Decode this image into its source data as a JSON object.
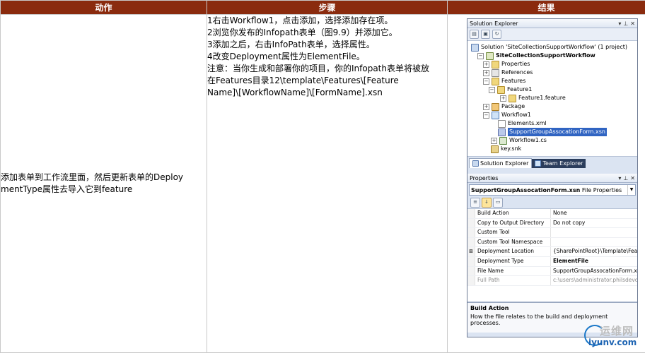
{
  "table": {
    "headers": [
      "动作",
      "步骤",
      "结果"
    ],
    "action_text_line1": "添加表单到工作流里面，然后更新表单的Deploy",
    "action_text_line2": "mentType属性去导入它到feature",
    "steps": [
      "1右击Workflow1，点击添加，选择添加存在项。",
      "2浏览你发布的Infopath表单（图9.9）并添加它。",
      "3添加之后，右击InfoPath表单，选择属性。",
      "4改变Deployment属性为ElementFile。",
      "注意：当你生成和部署你的项目，你的Infopath表单将被放",
      "在Features目录12\\template\\Features\\[Feature",
      "Name]\\[WorkflowName]\\[FormName].xsn"
    ]
  },
  "solution_explorer": {
    "title": "Solution Explorer",
    "title_buttons": [
      "▾",
      "⊥",
      "✕"
    ],
    "tree": [
      {
        "label": "Solution 'SiteCollectionSupportWorkflow' (1 project)",
        "icon": "solution-icon",
        "expander": ""
      },
      {
        "label": "SiteCollectionSupportWorkflow",
        "icon": "project-icon",
        "expander": "−"
      },
      {
        "label": "Properties",
        "icon": "folder-icon",
        "expander": "+"
      },
      {
        "label": "References",
        "icon": "references-icon",
        "expander": "+"
      },
      {
        "label": "Features",
        "icon": "folder-icon",
        "expander": "−"
      },
      {
        "label": "Feature1",
        "icon": "folder-icon",
        "expander": "−"
      },
      {
        "label": "Feature1.feature",
        "icon": "feature-icon",
        "expander": "+"
      },
      {
        "label": "Package",
        "icon": "package-icon",
        "expander": "+"
      },
      {
        "label": "Workflow1",
        "icon": "workflow-icon",
        "expander": "−"
      },
      {
        "label": "Elements.xml",
        "icon": "xml-file-icon",
        "expander": ""
      },
      {
        "label": "SupportGroupAssocationForm.xsn",
        "icon": "xsn-file-icon",
        "expander": ""
      },
      {
        "label": "Workflow1.cs",
        "icon": "cs-file-icon",
        "expander": "+"
      },
      {
        "label": "key.snk",
        "icon": "key-icon",
        "expander": ""
      }
    ],
    "tabs": [
      "Solution Explorer",
      "Team Explorer"
    ]
  },
  "properties": {
    "title": "Properties",
    "title_buttons": [
      "▾",
      "⊥",
      "✕"
    ],
    "object_name": "SupportGroupAssocationForm.xsn",
    "object_type": "File Properties",
    "rows": [
      {
        "key": "Build Action",
        "value": "None",
        "marker": "",
        "bold": false,
        "dim": false
      },
      {
        "key": "Copy to Output Directory",
        "value": "Do not copy",
        "marker": "",
        "bold": false,
        "dim": false
      },
      {
        "key": "Custom Tool",
        "value": "",
        "marker": "",
        "bold": false,
        "dim": false
      },
      {
        "key": "Custom Tool Namespace",
        "value": "",
        "marker": "",
        "bold": false,
        "dim": false
      },
      {
        "key": "Deployment Location",
        "value": "{SharePointRoot}\\Template\\Featu",
        "marker": "⊞",
        "bold": false,
        "dim": false
      },
      {
        "key": "Deployment Type",
        "value": "ElementFile",
        "marker": "",
        "bold": true,
        "dim": false
      },
      {
        "key": "File Name",
        "value": "SupportGroupAssocationForm.xsn",
        "marker": "",
        "bold": false,
        "dim": false
      },
      {
        "key": "Full Path",
        "value": "c:\\users\\administrator.philsdevdo",
        "marker": "",
        "bold": false,
        "dim": true
      }
    ],
    "description_title": "Build Action",
    "description_text": "How the file relates to the build and deployment processes."
  },
  "watermark": {
    "cn": "运维网",
    "url": "iyunv.com"
  }
}
